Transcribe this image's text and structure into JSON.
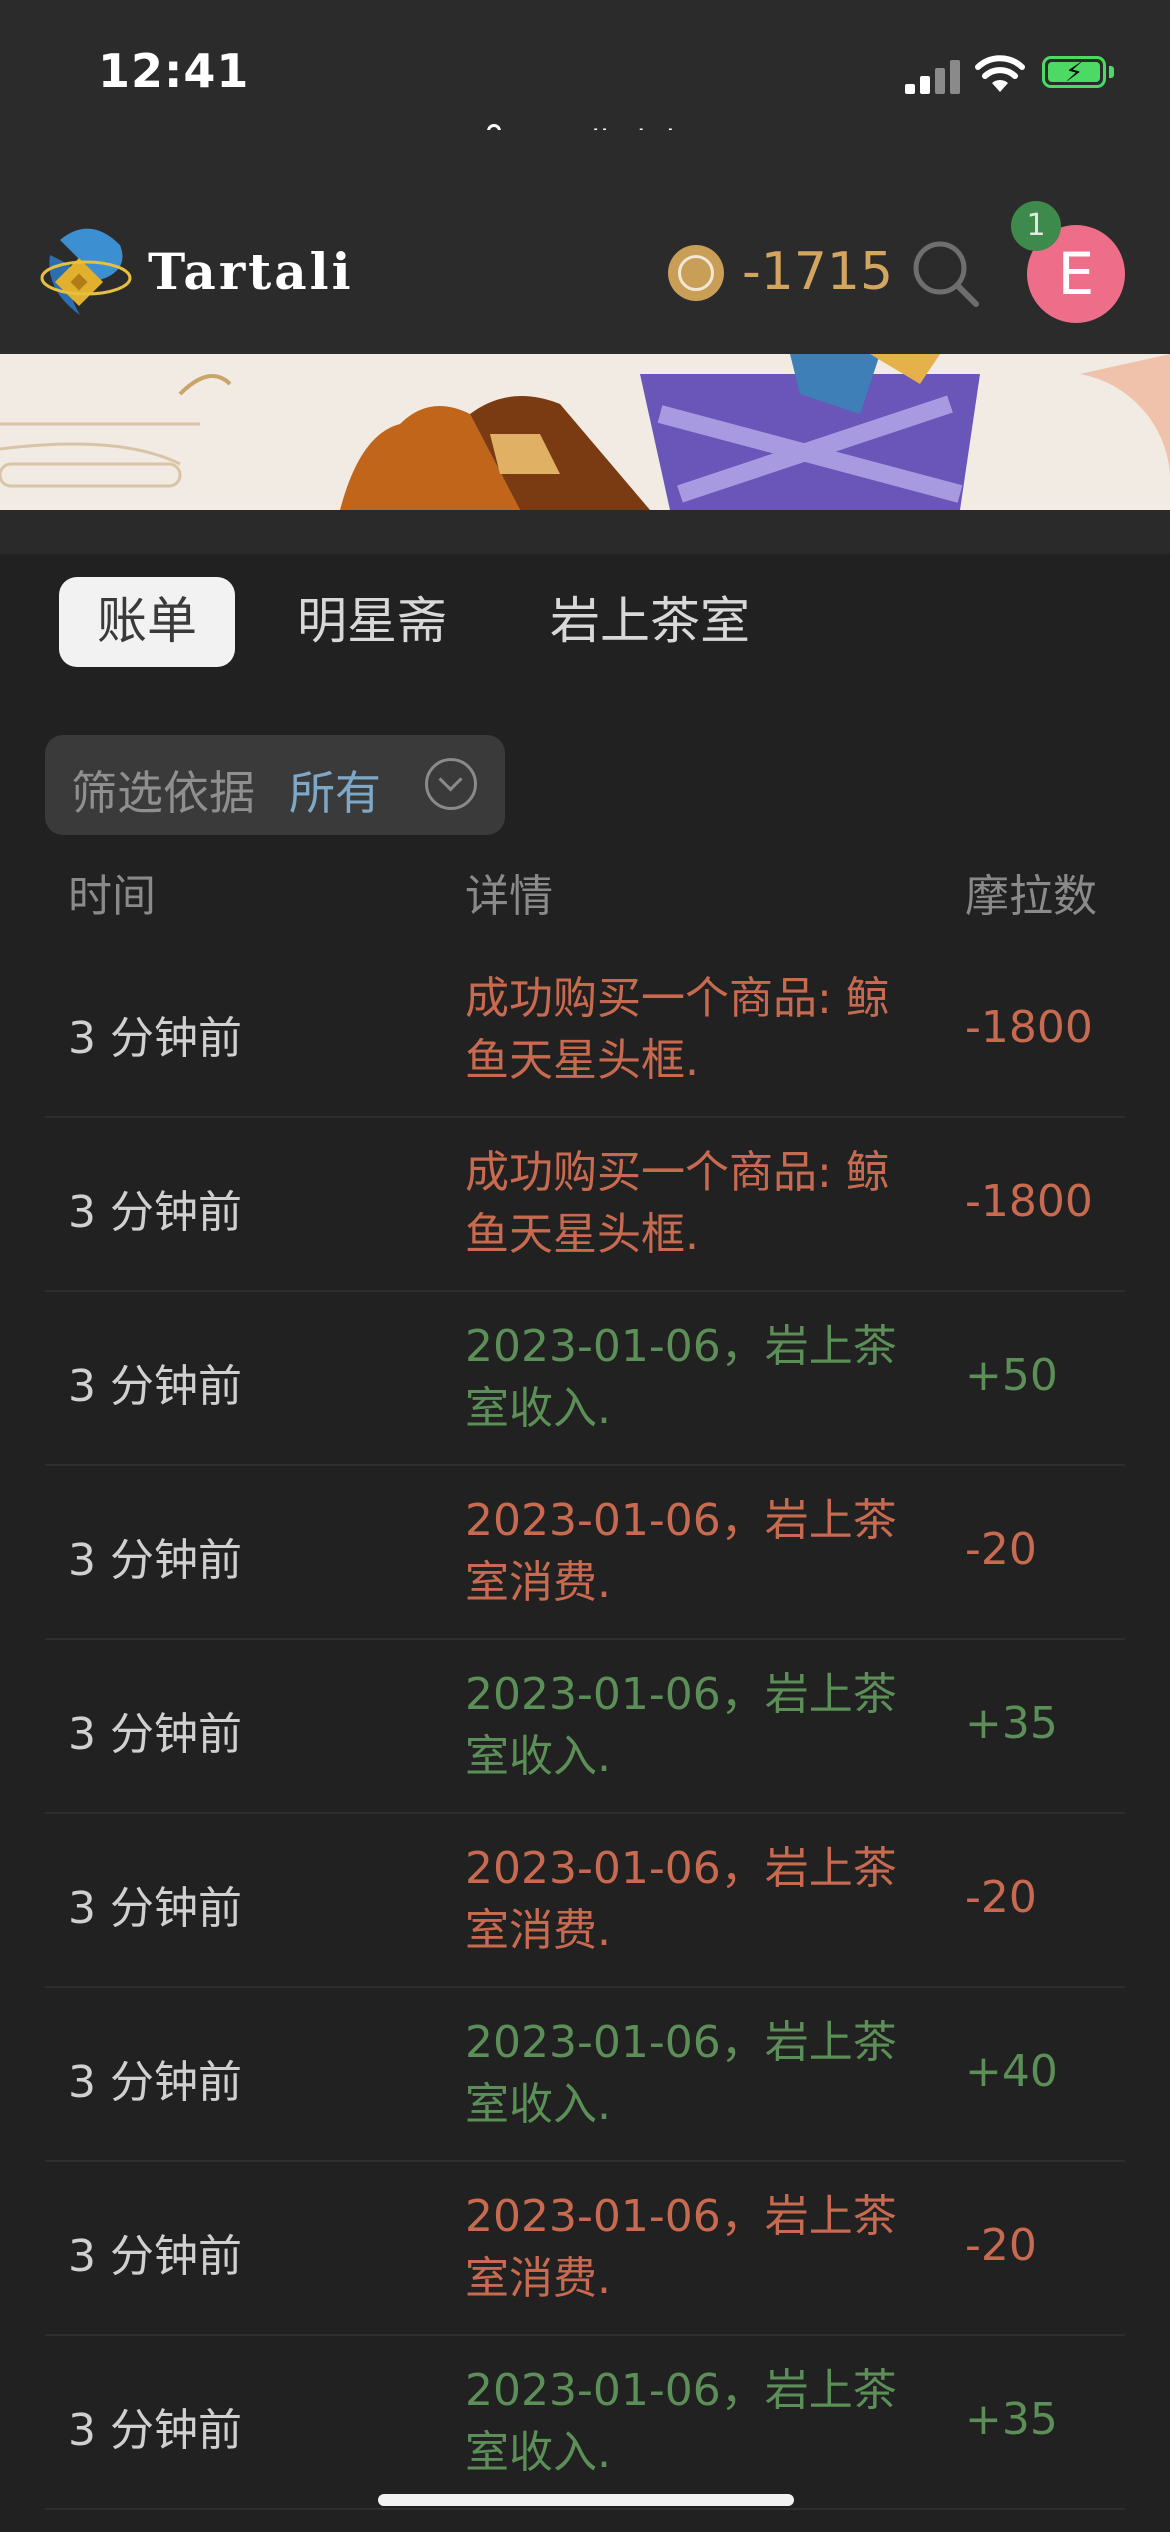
{
  "status_bar": {
    "time": "12:41"
  },
  "browser": {
    "url": "tartali.club"
  },
  "header": {
    "brand": "Tartali",
    "balance": "-1715",
    "avatar_letter": "E",
    "notification_count": "1",
    "colors": {
      "balance": "#d3a560",
      "avatar": "#ee6e89",
      "badge": "#3e8a4c"
    }
  },
  "tabs": [
    {
      "label": "账单",
      "active": true
    },
    {
      "label": "明星斋",
      "active": false
    },
    {
      "label": "岩上茶室",
      "active": false
    }
  ],
  "filter": {
    "label": "筛选依据",
    "value": "所有"
  },
  "table": {
    "headers": {
      "time": "时间",
      "detail": "详情",
      "amount": "摩拉数"
    },
    "rows": [
      {
        "time": "3 分钟前",
        "detail": "成功购买一个商品: 鲸鱼天星头框.",
        "amount": "-1800",
        "type": "debit"
      },
      {
        "time": "3 分钟前",
        "detail": "成功购买一个商品: 鲸鱼天星头框.",
        "amount": "-1800",
        "type": "debit"
      },
      {
        "time": "3 分钟前",
        "detail": "2023-01-06，岩上茶室收入.",
        "amount": "+50",
        "type": "credit"
      },
      {
        "time": "3 分钟前",
        "detail": "2023-01-06，岩上茶室消费.",
        "amount": "-20",
        "type": "debit"
      },
      {
        "time": "3 分钟前",
        "detail": "2023-01-06，岩上茶室收入.",
        "amount": "+35",
        "type": "credit"
      },
      {
        "time": "3 分钟前",
        "detail": "2023-01-06，岩上茶室消费.",
        "amount": "-20",
        "type": "debit"
      },
      {
        "time": "3 分钟前",
        "detail": "2023-01-06，岩上茶室收入.",
        "amount": "+40",
        "type": "credit"
      },
      {
        "time": "3 分钟前",
        "detail": "2023-01-06，岩上茶室消费.",
        "amount": "-20",
        "type": "debit"
      },
      {
        "time": "3 分钟前",
        "detail": "2023-01-06，岩上茶室收入.",
        "amount": "+35",
        "type": "credit"
      }
    ]
  }
}
